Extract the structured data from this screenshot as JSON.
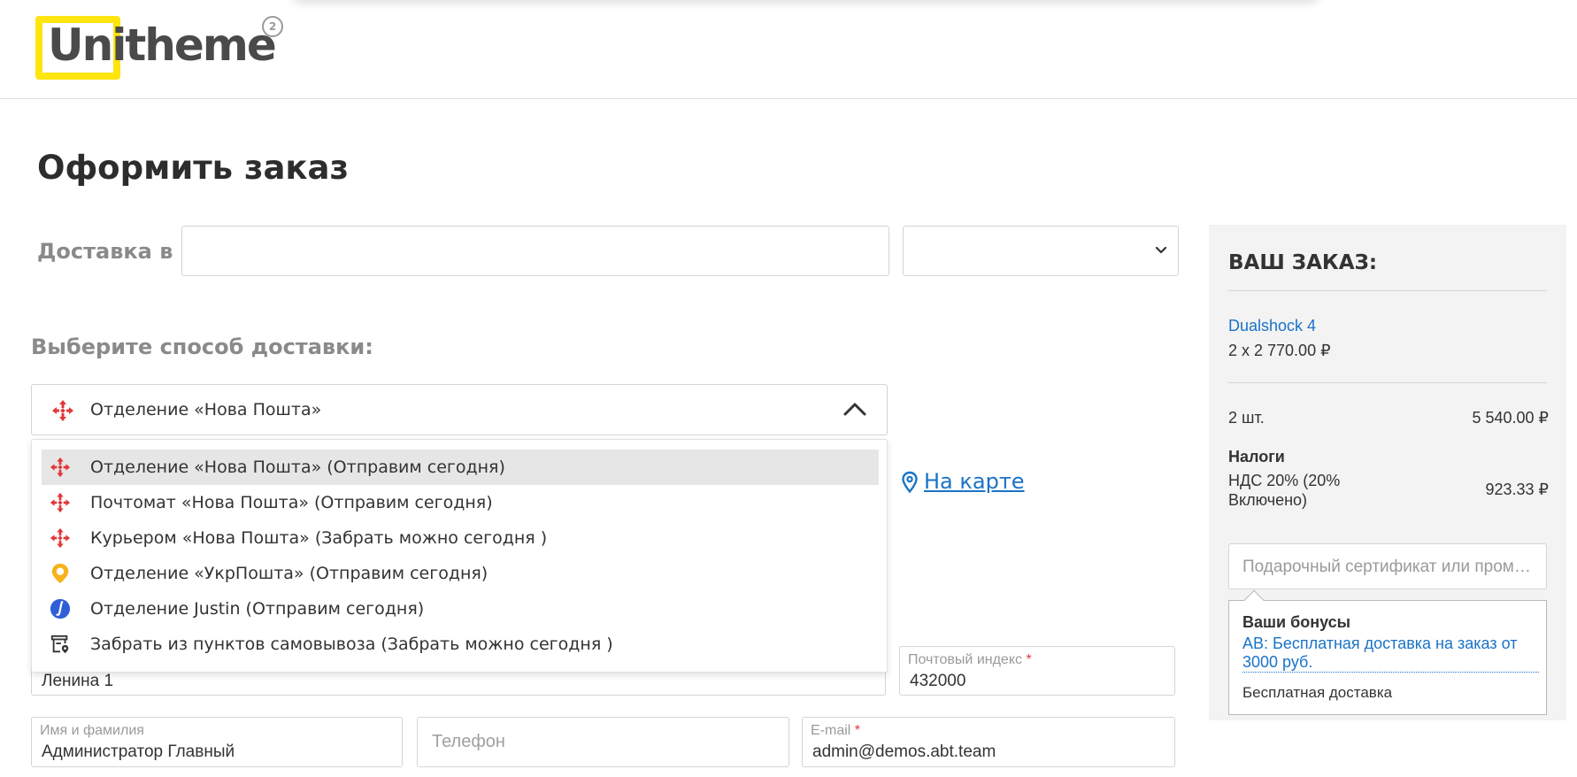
{
  "header": {
    "logo_text": "Unitheme",
    "logo_version": "2"
  },
  "page": {
    "title": "Оформить заказ"
  },
  "shipping": {
    "label": "Доставка в",
    "city_value": "",
    "region_value": ""
  },
  "delivery": {
    "section_title": "Выберите способ доставки:",
    "selected_label": "Отделение «Нова Пошта»",
    "options": [
      {
        "label": "Отделение «Нова Пошта» (Отправим сегодня)",
        "icon": "nova-poshta-icon",
        "selected": true
      },
      {
        "label": "Почтомат «Нова Пошта» (Отправим сегодня)",
        "icon": "nova-poshta-icon",
        "selected": false
      },
      {
        "label": "Курьером «Нова Пошта» (Забрать можно сегодня )",
        "icon": "nova-poshta-icon",
        "selected": false
      },
      {
        "label": "Отделение «УкрПошта» (Отправим сегодня)",
        "icon": "ukrposhta-icon",
        "selected": false
      },
      {
        "label": "Отделение Justin (Отправим сегодня)",
        "icon": "justin-icon",
        "selected": false
      },
      {
        "label": "Забрать из пунктов самовывоза (Забрать можно сегодня )",
        "icon": "pickup-point-icon",
        "selected": false
      }
    ],
    "map_link": "На карте"
  },
  "form": {
    "address_value": "Ленина 1",
    "zip_label": "Почтовый индекс",
    "zip_value": "432000",
    "name_label": "Имя и фамилия",
    "name_value": "Администратор Главный",
    "phone_placeholder": "Телефон",
    "email_label": "E-mail",
    "email_value": "admin@demos.abt.team",
    "required_mark": "*"
  },
  "order": {
    "title": "ВАШ ЗАКАЗ:",
    "product_name": "Dualshock 4",
    "product_price": "2 x 2 770.00 ₽",
    "qty_label": "2 шт.",
    "qty_total": "5 540.00 ₽",
    "taxes_label": "Налоги",
    "vat_label": "НДС 20% (20% Включено)",
    "vat_value": "923.33 ₽",
    "gift_placeholder": "Подарочный сертификат или промо-код",
    "bonus_title": "Ваши бонусы",
    "bonus_link": "АВ: Бесплатная доставка на заказ от 3000 руб.",
    "bonus_desc": "Бесплатная доставка"
  },
  "colors": {
    "accent_blue": "#1a73c7",
    "logo_yellow": "#fee50e",
    "nova_poshta_red": "#e2363a",
    "ukrposhta_yellow": "#f6b21b",
    "justin_blue": "#2f5fd8"
  }
}
